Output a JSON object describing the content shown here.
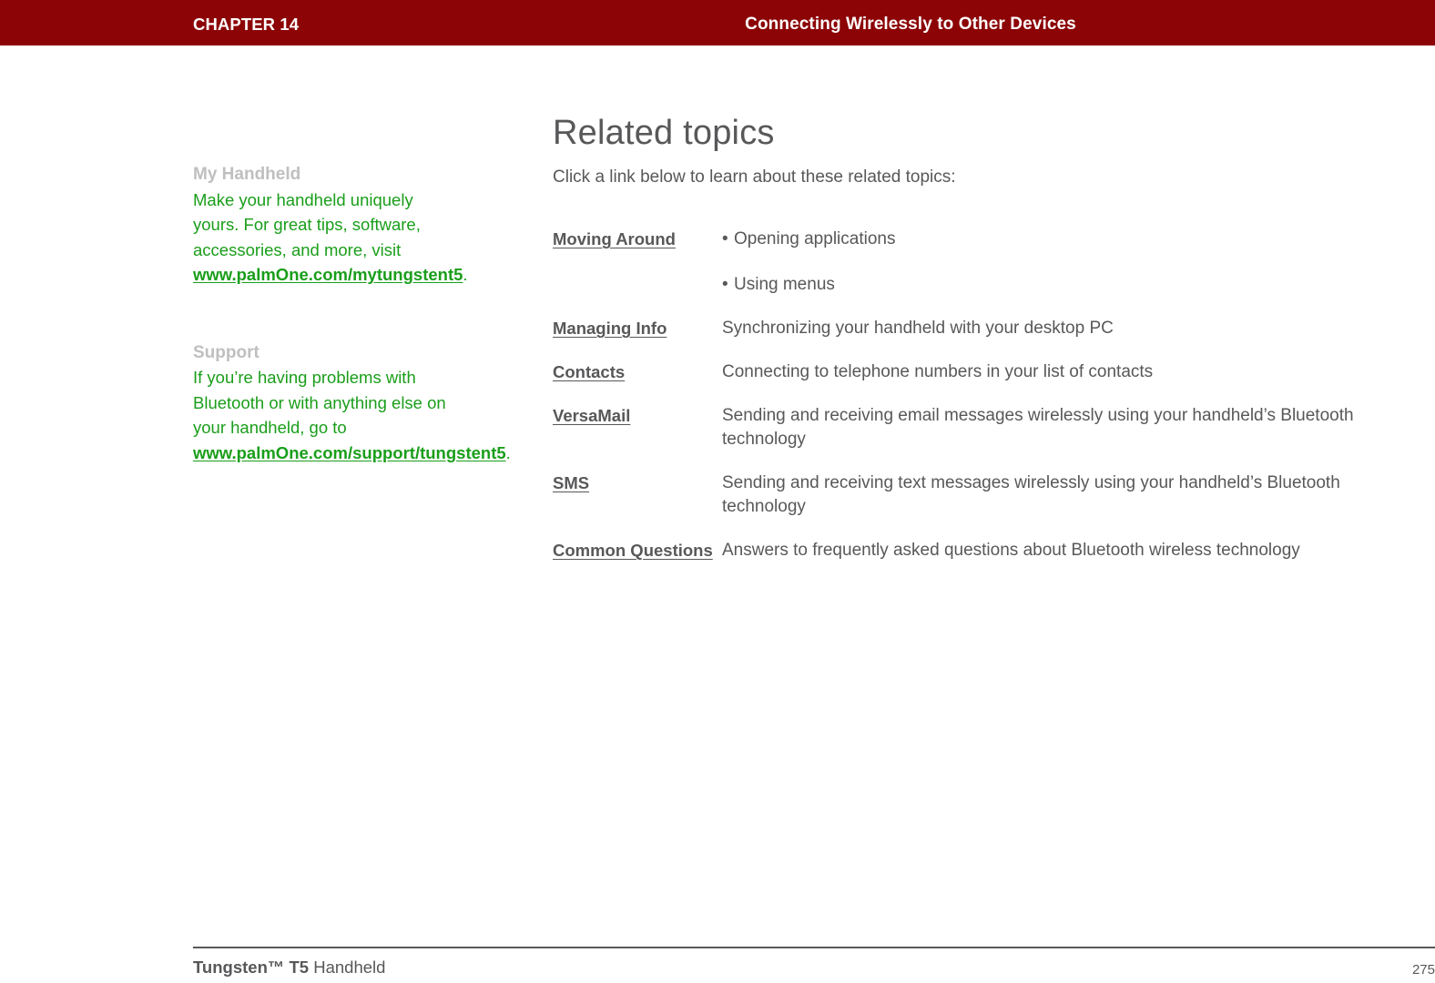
{
  "header": {
    "chapter": "CHAPTER 14",
    "title": "Connecting Wirelessly to Other Devices",
    "bar_color": "#8c0406",
    "text_color": "#ffffff"
  },
  "sidebar": {
    "blocks": [
      {
        "heading": "My Handheld",
        "body_before": "Make your handheld uniquely yours. For great tips, software, accessories, and more, visit ",
        "link": "www.palmOne.com/mytungstent5",
        "body_after": "."
      },
      {
        "heading": "Support",
        "body_before": "If you’re having problems with Bluetooth or with anything else on your handheld, go to ",
        "link": "www.palmOne.com/support/tungstent5",
        "body_after": "."
      }
    ],
    "heading_color": "#bfbfbf",
    "body_color": "#1a9e1a"
  },
  "main": {
    "title": "Related topics",
    "intro": "Click a link below to learn about these related topics:",
    "text_color": "#58585a"
  },
  "topics": [
    {
      "link": "Moving Around",
      "bullets": [
        "Opening applications",
        "Using menus"
      ],
      "desc": ""
    },
    {
      "link": "Managing Info",
      "bullets": [],
      "desc": "Synchronizing your handheld with your desktop PC"
    },
    {
      "link": "Contacts",
      "bullets": [],
      "desc": "Connecting to telephone numbers in your list of contacts"
    },
    {
      "link": "VersaMail",
      "bullets": [],
      "desc": "Sending and receiving email messages wirelessly using your handheld’s Bluetooth technology"
    },
    {
      "link": "SMS",
      "bullets": [],
      "desc": "Sending and receiving text messages wirelessly using your handheld’s Bluetooth technology"
    },
    {
      "link": "Common Questions",
      "bullets": [],
      "desc": "Answers to frequently asked questions about Bluetooth wireless technology"
    }
  ],
  "bullet_glyph": "•",
  "footer": {
    "product_bold": "Tungsten™ T5",
    "product_rest": " Handheld",
    "page_number": "275"
  }
}
